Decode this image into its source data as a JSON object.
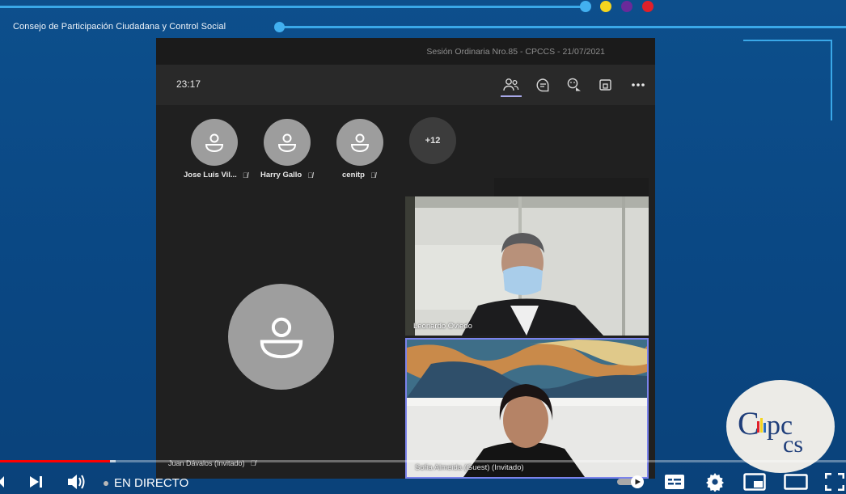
{
  "org": {
    "name": "Consejo de Participación Ciudadana y Control Social"
  },
  "header": {
    "dots": [
      "#42b0f0",
      "#f4d51e",
      "#6a2a9a",
      "#e0202a"
    ]
  },
  "meeting": {
    "title": "Sesión Ordinaria Nro.85 - CPCCS - 21/07/2021",
    "timer": "23:17",
    "toolbar": {
      "participants": "people-icon",
      "chat": "chat-icon",
      "reactions": "reactions-icon",
      "share": "share-tray-icon",
      "more": "more-options-icon"
    }
  },
  "participants": [
    {
      "name": "Jose Luis Vil..."
    },
    {
      "name": "Harry Gallo"
    },
    {
      "name": "cenitp"
    }
  ],
  "overflow": {
    "count": "+12"
  },
  "tiles": {
    "video1": {
      "name": "Leonardo Oviedo"
    },
    "video2": {
      "name": "Sofia Almeida (Guest) (Invitado)"
    }
  },
  "main_tile": {
    "name": "Juan Dávalos (Invitado)"
  },
  "player": {
    "live_label": "EN DIRECTO",
    "progress_fraction": 0.13,
    "buffer_fraction": 0.137
  },
  "logo": {
    "text": "CPCCS"
  }
}
